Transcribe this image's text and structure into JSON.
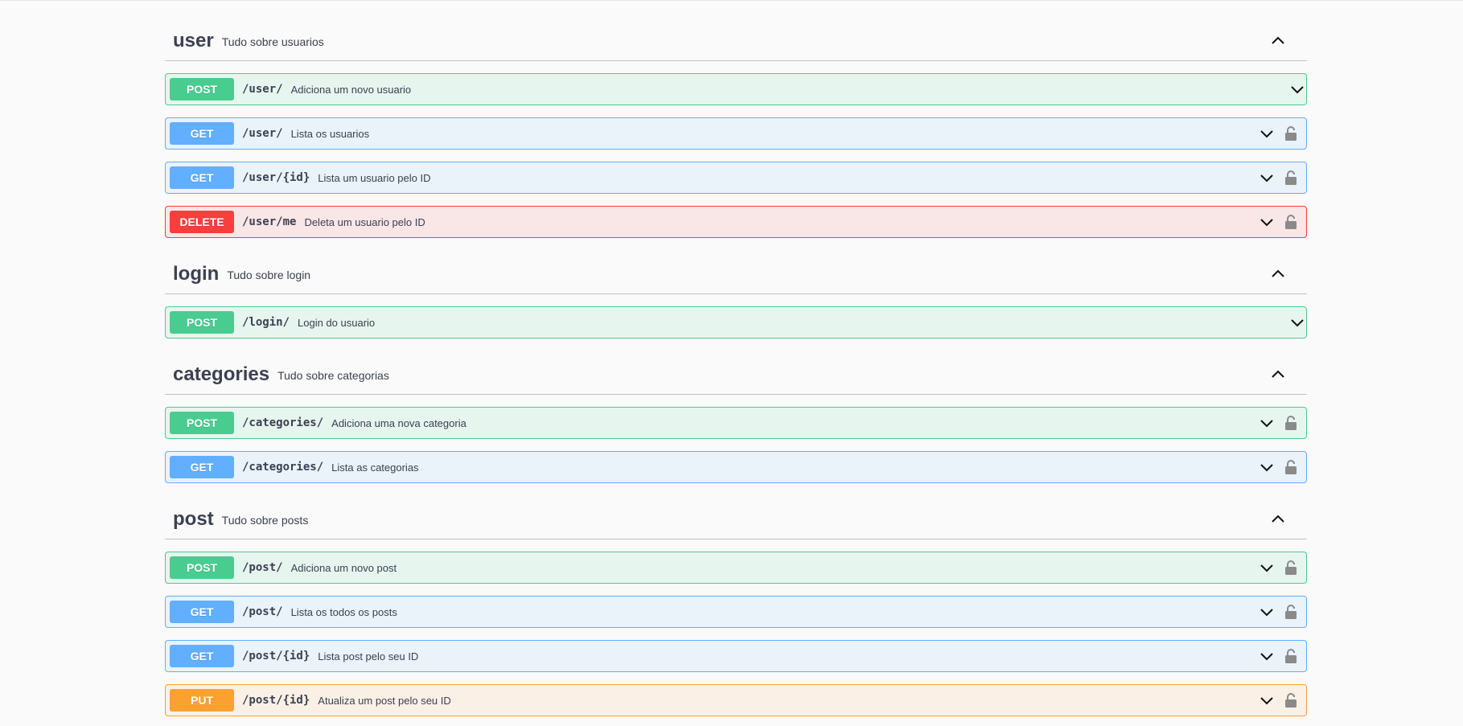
{
  "sections": [
    {
      "name": "user",
      "description": "Tudo sobre usuarios",
      "operations": [
        {
          "method": "POST",
          "path": "/user/",
          "summary": "Adiciona um novo usuario",
          "locked": false
        },
        {
          "method": "GET",
          "path": "/user/",
          "summary": "Lista os usuarios",
          "locked": true
        },
        {
          "method": "GET",
          "path": "/user/{id}",
          "summary": "Lista um usuario pelo ID",
          "locked": true
        },
        {
          "method": "DELETE",
          "path": "/user/me",
          "summary": "Deleta um usuario pelo ID",
          "locked": true
        }
      ]
    },
    {
      "name": "login",
      "description": "Tudo sobre login",
      "operations": [
        {
          "method": "POST",
          "path": "/login/",
          "summary": "Login do usuario",
          "locked": false
        }
      ]
    },
    {
      "name": "categories",
      "description": "Tudo sobre categorias",
      "operations": [
        {
          "method": "POST",
          "path": "/categories/",
          "summary": "Adiciona uma nova categoria",
          "locked": true
        },
        {
          "method": "GET",
          "path": "/categories/",
          "summary": "Lista as categorias",
          "locked": true
        }
      ]
    },
    {
      "name": "post",
      "description": "Tudo sobre posts",
      "operations": [
        {
          "method": "POST",
          "path": "/post/",
          "summary": "Adiciona um novo post",
          "locked": true
        },
        {
          "method": "GET",
          "path": "/post/",
          "summary": "Lista os todos os posts",
          "locked": true
        },
        {
          "method": "GET",
          "path": "/post/{id}",
          "summary": "Lista post pelo seu ID",
          "locked": true
        },
        {
          "method": "PUT",
          "path": "/post/{id}",
          "summary": "Atualiza um post pelo seu ID",
          "locked": true
        }
      ]
    }
  ],
  "icons": {
    "collapse": "chevron-up-icon",
    "expand": "chevron-down-icon",
    "auth": "lock-icon"
  },
  "colors": {
    "post": "#49cc90",
    "get": "#61affe",
    "delete": "#f93e3e",
    "put": "#fca130",
    "text": "#3b4151"
  }
}
